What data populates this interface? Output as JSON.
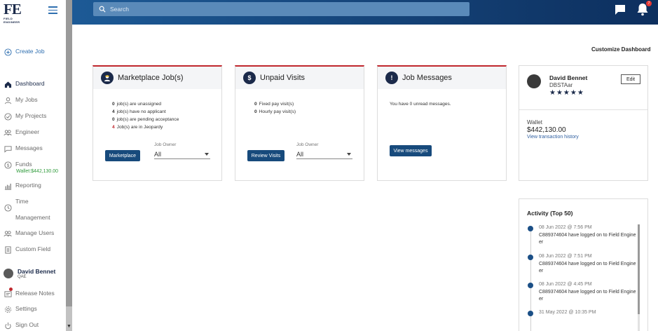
{
  "logo": {
    "text": "FE",
    "sub": "FIELD ENGINEER"
  },
  "sidebar": {
    "create_job": "Create Job",
    "items": [
      {
        "label": "Dashboard"
      },
      {
        "label": "My Jobs"
      },
      {
        "label": "My Projects"
      },
      {
        "label": "Engineer"
      },
      {
        "label": "Messages"
      },
      {
        "label": "Funds"
      },
      {
        "label": "Reporting"
      },
      {
        "label": "Time"
      },
      {
        "label": "Management"
      },
      {
        "label": "Manage Users"
      },
      {
        "label": "Custom Field"
      },
      {
        "label": "Release Notes"
      },
      {
        "label": "Settings"
      },
      {
        "label": "Sign Out"
      }
    ],
    "funds_wallet": "Wallet:$442,130.00",
    "user": {
      "name": "David Bennet",
      "role": "QAE"
    }
  },
  "header": {
    "search_placeholder": "Search",
    "notification_count": "7",
    "accent_color": "#1d5a96"
  },
  "customize_label": "Customize Dashboard",
  "cards": {
    "marketplace": {
      "title": "Marketplace Job(s)",
      "stats": [
        {
          "n": "0",
          "text": "job(s) are unassigned"
        },
        {
          "n": "4",
          "text": "job(s) have no applicant"
        },
        {
          "n": "0",
          "text": "job(s) are pending acceptance"
        },
        {
          "n": "4",
          "text": "Job(s) are in Jeopardy"
        }
      ],
      "button": "Marketplace",
      "owner_label": "Job Owner",
      "owner_value": "All"
    },
    "unpaid": {
      "title": "Unpaid Visits",
      "stats": [
        {
          "n": "0",
          "text": "Fixed pay visit(s)"
        },
        {
          "n": "0",
          "text": "Hourly pay visit(s)"
        }
      ],
      "button": "Review Visits",
      "owner_label": "Job Owner",
      "owner_value": "All"
    },
    "messages": {
      "title": "Job Messages",
      "text": "You have 0 unread messages.",
      "button": "View messages"
    }
  },
  "profile": {
    "name": "David Bennet",
    "role": "DBSTAar",
    "stars": "★★★★★",
    "edit": "Edit",
    "wallet_label": "Wallet",
    "wallet_value": "$442,130.00",
    "history_link": "View transaction history"
  },
  "activity": {
    "title": "Activity (Top 50)",
    "items": [
      {
        "date": "08 Jun 2022 @ 7:56 PM",
        "text": "C889374604 have logged on to Field Engineer"
      },
      {
        "date": "08 Jun 2022 @ 7:51 PM",
        "text": "C889374604 have logged on to Field Engineer"
      },
      {
        "date": "08 Jun 2022 @ 4:45 PM",
        "text": "C889374604 have logged on to Field Engineer"
      },
      {
        "date": "31 May 2022 @ 10:35 PM",
        "text": ""
      }
    ]
  }
}
